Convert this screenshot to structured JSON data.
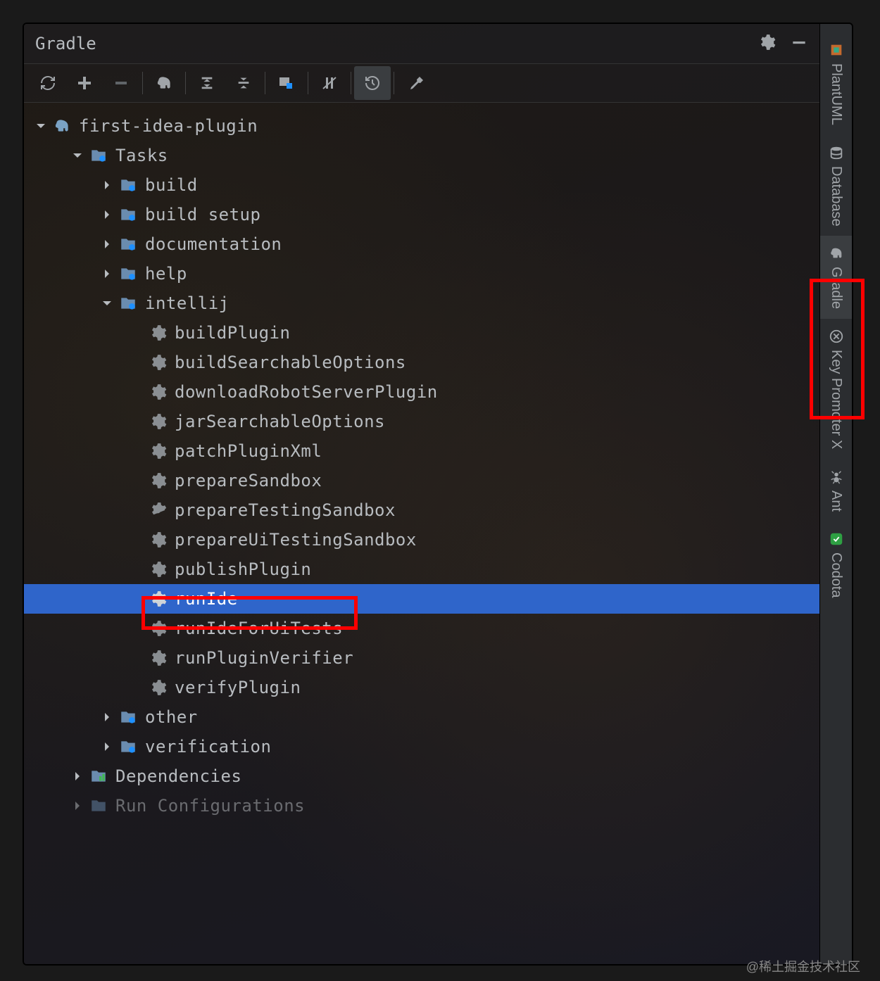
{
  "panel": {
    "title": "Gradle"
  },
  "sidebar": {
    "items": [
      {
        "label": "PlantUML"
      },
      {
        "label": "Database"
      },
      {
        "label": "Gradle"
      },
      {
        "label": "Key Promoter X"
      },
      {
        "label": "Ant"
      },
      {
        "label": "Codota"
      }
    ]
  },
  "tree": {
    "root": {
      "label": "first-idea-plugin",
      "tasks": {
        "label": "Tasks",
        "groups": {
          "build": "build",
          "build_setup": "build setup",
          "documentation": "documentation",
          "help": "help",
          "intellij": "intellij",
          "other": "other",
          "verification": "verification"
        },
        "intellij_tasks": [
          "buildPlugin",
          "buildSearchableOptions",
          "downloadRobotServerPlugin",
          "jarSearchableOptions",
          "patchPluginXml",
          "prepareSandbox",
          "prepareTestingSandbox",
          "prepareUiTestingSandbox",
          "publishPlugin",
          "runIde",
          "runIdeForUiTests",
          "runPluginVerifier",
          "verifyPlugin"
        ]
      },
      "dependencies": "Dependencies",
      "run_configs": "Run Configurations"
    }
  },
  "watermark": "@稀土掘金技术社区"
}
